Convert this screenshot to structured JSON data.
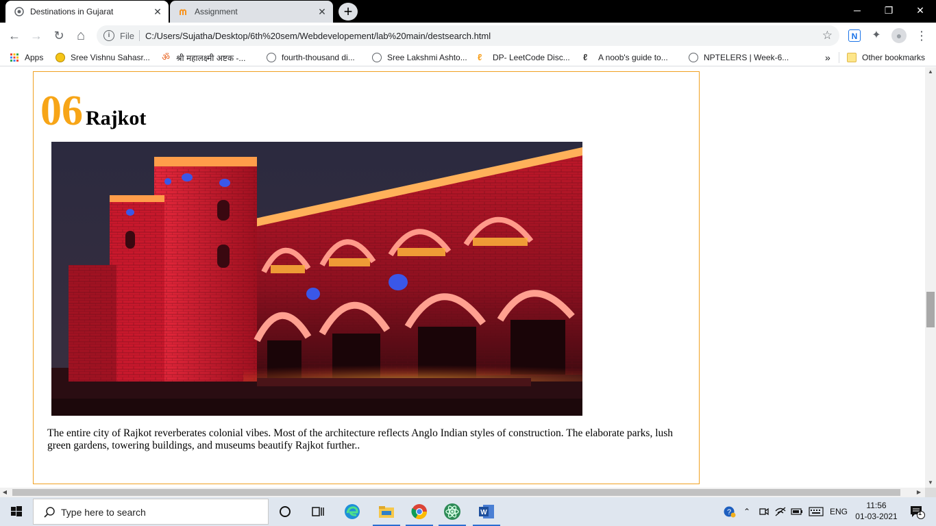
{
  "browser": {
    "tabs": [
      {
        "title": "Destinations in Gujarat",
        "active": true,
        "close": "✕"
      },
      {
        "title": "Assignment",
        "active": false,
        "close": "✕"
      }
    ],
    "new_tab": "+",
    "window_controls": {
      "minimize": "─",
      "restore": "❐",
      "close": "✕"
    },
    "nav": {
      "back": "←",
      "forward": "→",
      "reload": "↻",
      "home": "⌂"
    },
    "omnibox": {
      "scheme": "File",
      "url": "C:/Users/Sujatha/Desktop/6th%20sem/Webdevelopement/lab%20main/destsearch.html",
      "star": "☆"
    },
    "extensions": {
      "n_ext": "N",
      "puzzle": "✦",
      "profile": "●",
      "menu": "⋮"
    }
  },
  "bookmarks": {
    "items": [
      {
        "label": "Apps",
        "icon": "apps-grid-icon"
      },
      {
        "label": "Sree Vishnu Sahasr...",
        "icon": "emoji-icon"
      },
      {
        "label": "श्री महालक्ष्मी अष्टक -...",
        "icon": "om-icon"
      },
      {
        "label": "fourth-thousand di...",
        "icon": "globe-icon"
      },
      {
        "label": "Sree Lakshmi Ashto...",
        "icon": "globe-icon"
      },
      {
        "label": "DP- LeetCode Disc...",
        "icon": "leetcode-icon"
      },
      {
        "label": "A noob's guide to...",
        "icon": "leetcode-icon"
      },
      {
        "label": "NPTELERS | Week-6...",
        "icon": "globe-icon"
      }
    ],
    "overflow": "»",
    "other": "Other bookmarks"
  },
  "page": {
    "number": "06",
    "city": "Rajkot",
    "description": "The entire city of Rajkot reverberates colonial vibes. Most of the architecture reflects Anglo Indian styles of construction. The elaborate parks, lush green gardens, towering buildings, and museums beautify Rajkot further.."
  },
  "taskbar": {
    "search_placeholder": "Type here to search",
    "lang": "ENG",
    "time": "11:56",
    "date": "01-03-2021",
    "notification_count": "1"
  },
  "colors": {
    "accent_number": "#f7a517",
    "card_border": "#f0a020",
    "taskbar": "#dfe6ef"
  }
}
